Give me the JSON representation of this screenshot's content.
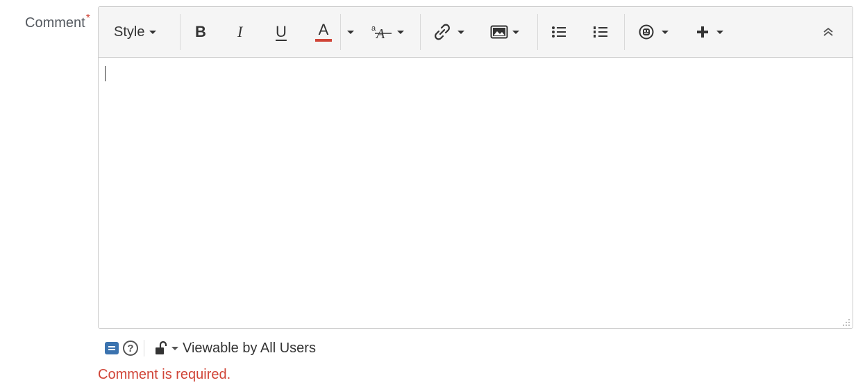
{
  "field": {
    "label": "Comment",
    "required_marker": "*"
  },
  "toolbar": {
    "style_label": "Style",
    "bold_label": "B",
    "italic_label": "I",
    "underline_label": "U",
    "text_color_label": "A",
    "text_color_value": "#d04437",
    "icons": [
      "style-dropdown",
      "bold-icon",
      "italic-icon",
      "underline-icon",
      "text-color-icon",
      "text-format-icon",
      "link-icon",
      "image-icon",
      "bullet-list-icon",
      "numbered-list-icon",
      "emoticon-icon",
      "insert-more-icon",
      "collapse-toolbar-icon"
    ]
  },
  "editor": {
    "value": ""
  },
  "footer": {
    "visibility_label": "Viewable by All Users"
  },
  "validation": {
    "error_message": "Comment is required."
  },
  "colors": {
    "error": "#d04437",
    "wiki_icon": "#3b73af",
    "toolbar_bg": "#f5f5f5",
    "border": "#cccccc"
  }
}
